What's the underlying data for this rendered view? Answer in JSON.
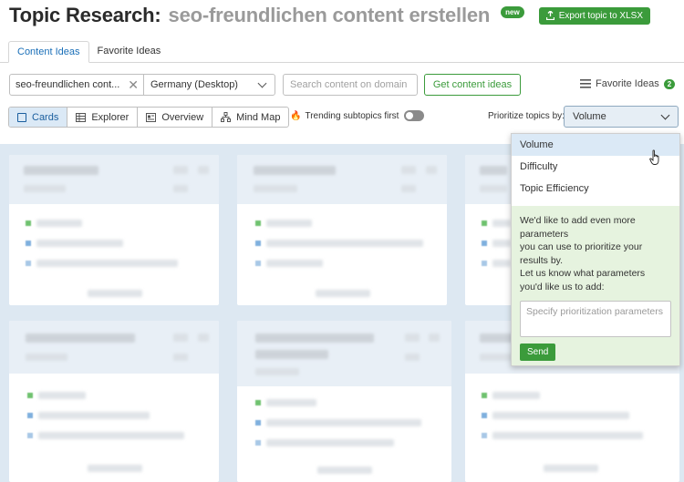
{
  "header": {
    "title": "Topic Research:",
    "topic": "seo-freundlichen content erstellen",
    "new_badge": "new",
    "export_label": "Export topic to XLSX"
  },
  "tabs": [
    {
      "label": "Content Ideas",
      "active": true
    },
    {
      "label": "Favorite Ideas",
      "active": false
    }
  ],
  "controls": {
    "keyword_value": "seo-freundlichen cont...",
    "country_value": "Germany (Desktop)",
    "search_placeholder": "Search content on domain",
    "get_ideas_label": "Get content ideas",
    "favorite_label": "Favorite Ideas",
    "favorite_count": "2"
  },
  "views": [
    {
      "label": "Cards",
      "active": true
    },
    {
      "label": "Explorer",
      "active": false
    },
    {
      "label": "Overview",
      "active": false
    },
    {
      "label": "Mind Map",
      "active": false
    }
  ],
  "trending_label": "Trending subtopics first",
  "prioritize": {
    "label": "Prioritize topics by:",
    "selected": "Volume",
    "options": [
      "Volume",
      "Difficulty",
      "Topic Efficiency"
    ],
    "feedback_text": "We'd like to add even more\nparameters\nyou can use to prioritize your\nresults by.\nLet us know what parameters\nyou'd like us to add:",
    "feedback_placeholder": "Specify prioritization parameters",
    "send_label": "Send"
  },
  "colors": {
    "green": "#3b9b3b",
    "blue_link": "#1a6fb8",
    "card_bg": "#dde8f2"
  }
}
